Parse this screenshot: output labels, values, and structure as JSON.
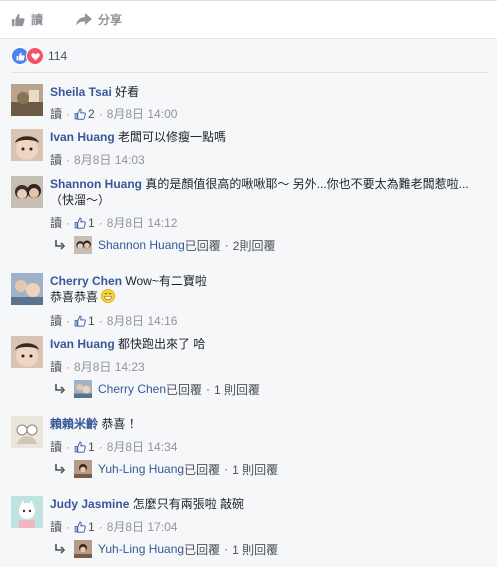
{
  "actions": {
    "read": "讀",
    "share": "分享"
  },
  "reaction_count": "114",
  "comments": [
    {
      "author": "Sheila Tsai",
      "text": "好看",
      "read": "讀",
      "likes": "2",
      "time": "8月8日 14:00"
    },
    {
      "author": "Ivan Huang",
      "text": "老闆可以修瘦一點嗎",
      "read": "讀",
      "time": "8月8日 14:03"
    },
    {
      "author": "Shannon Huang",
      "text": "真的是顏值很高的啾啾耶～ 另外...你也不要太為難老闆惹啦...（快溜～）",
      "read": "讀",
      "likes": "1",
      "time": "8月8日 14:12",
      "reply": {
        "name": "Shannon Huang",
        "label": "已回覆",
        "count": "2則回覆"
      }
    },
    {
      "author": "Cherry Chen",
      "text": "Wow~有二寶啦",
      "text2": "恭喜恭喜",
      "read": "讀",
      "likes": "1",
      "time": "8月8日 14:16"
    },
    {
      "author": "Ivan Huang",
      "text": "都快跑出來了 哈",
      "read": "讀",
      "time": "8月8日 14:23",
      "reply": {
        "name": "Cherry Chen",
        "label": "已回覆",
        "count": "1 則回覆"
      }
    },
    {
      "author": "賴賴米齡",
      "text": "恭喜 ！",
      "read": "讀",
      "likes": "1",
      "time": "8月8日 14:34",
      "reply": {
        "name": "Yuh-Ling Huang",
        "label": "已回覆",
        "count": "1 則回覆"
      }
    },
    {
      "author": "Judy Jasmine",
      "text": "怎麼只有兩張啦 敲碗",
      "read": "讀",
      "likes": "1",
      "time": "8月8日 17:04",
      "reply": {
        "name": "Yuh-Ling Huang",
        "label": "已回覆",
        "count": "1 則回覆"
      }
    }
  ],
  "separator": "·",
  "colors": {
    "link": "#365899",
    "meta": "#90949c",
    "like": "#4c83f3",
    "love": "#f25268"
  }
}
